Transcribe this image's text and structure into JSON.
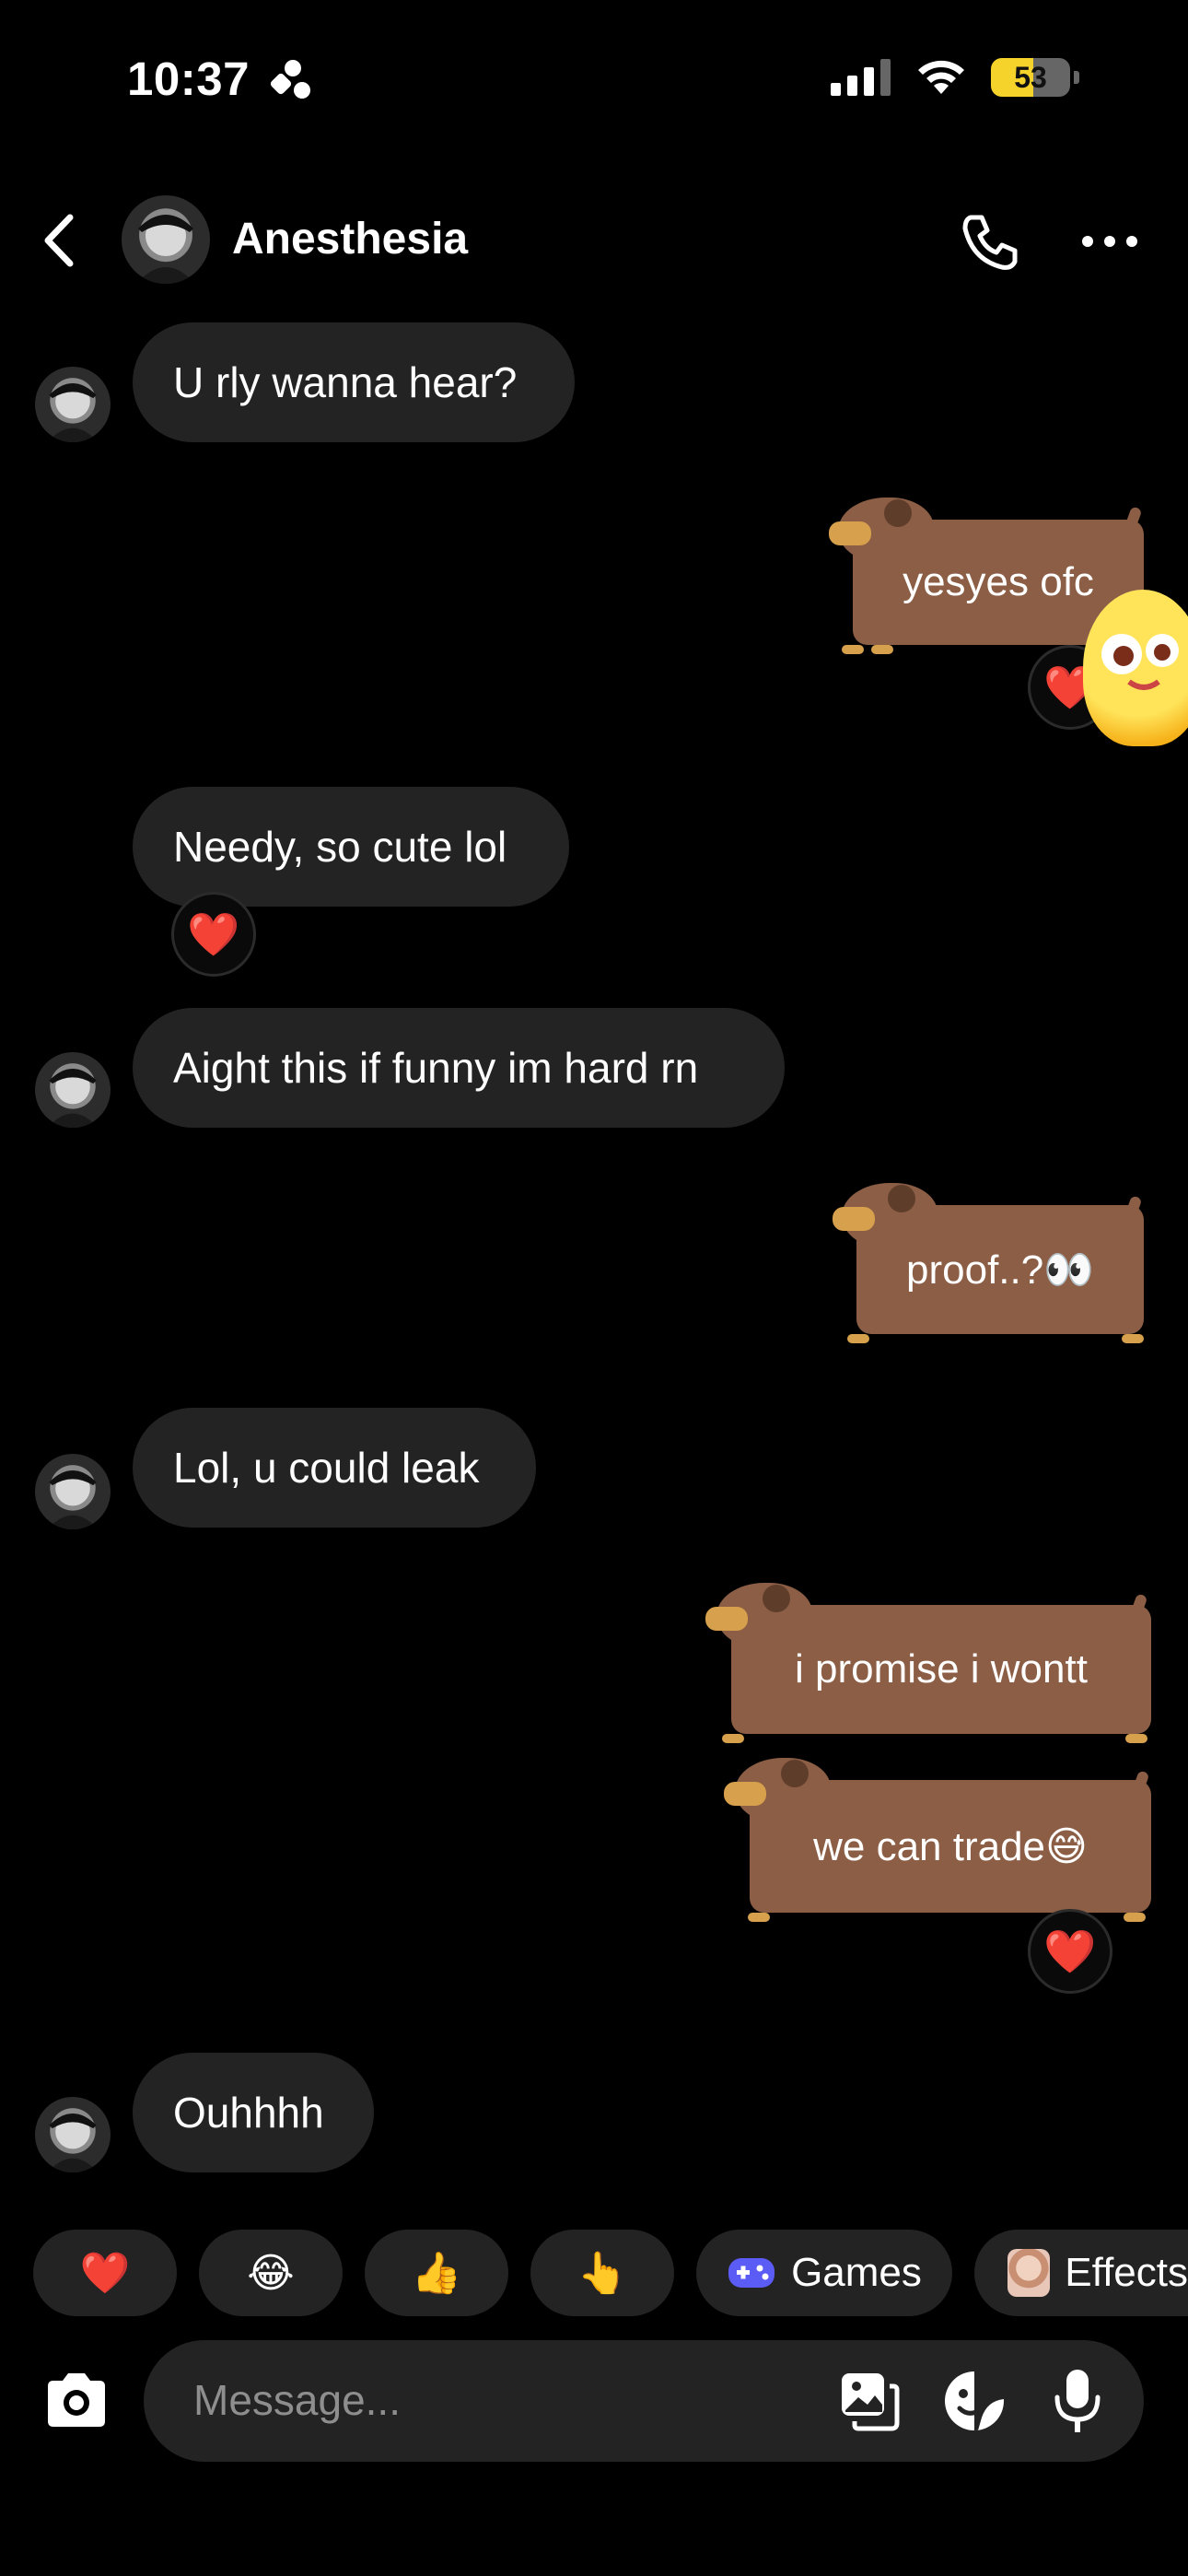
{
  "status_bar": {
    "time": "10:37",
    "battery": "53",
    "battery_level": 0.53
  },
  "header": {
    "contact_name": "Anesthesia"
  },
  "messages": [
    {
      "side": "in",
      "text": "U rly wanna hear?"
    },
    {
      "side": "out",
      "text": "yesyes ofc"
    },
    {
      "side": "in",
      "text": "Needy, so cute lol",
      "reaction": "❤️"
    },
    {
      "side": "in",
      "text": "Aight this if funny im hard rn"
    },
    {
      "side": "out",
      "text": "proof..?👀"
    },
    {
      "side": "in",
      "text": "Lol, u could leak"
    },
    {
      "side": "out",
      "text": "i promise i wontt"
    },
    {
      "side": "out",
      "text": "we can trade😅",
      "reaction": "❤️"
    },
    {
      "side": "in",
      "text": "Ouhhhh"
    }
  ],
  "quick_actions": {
    "heart": "❤️",
    "laugh": "😂",
    "thumbs_up": "👍",
    "point": "👆",
    "games": "Games",
    "effects": "Effects"
  },
  "composer": {
    "placeholder": "Message..."
  },
  "colors": {
    "background": "#000000",
    "bubble": "#232323",
    "dog_bubble": "#8b5e45",
    "battery": "#f5d32b",
    "games_icon": "#5b5cf6"
  }
}
